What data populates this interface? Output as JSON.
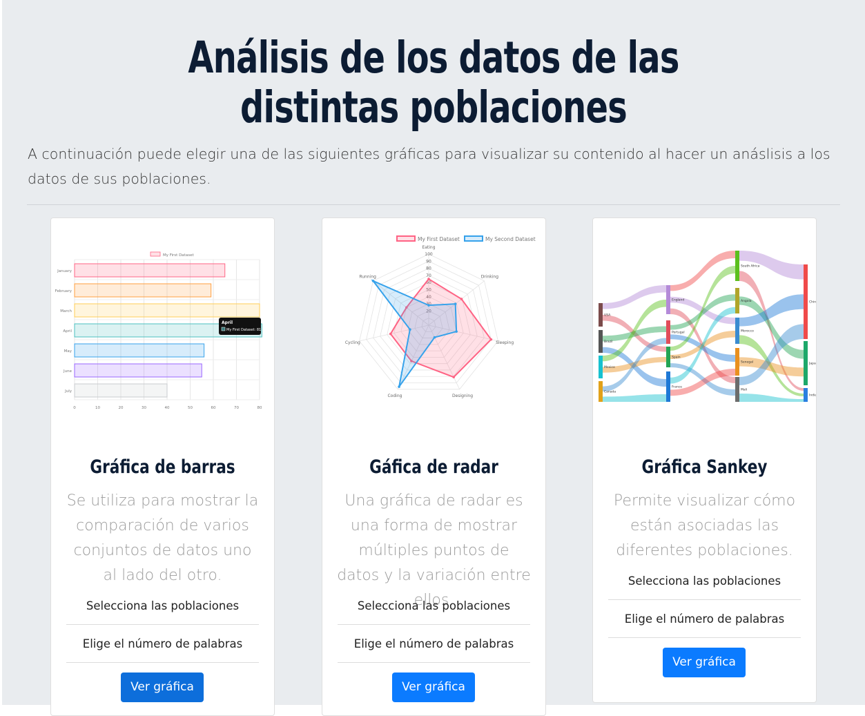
{
  "page": {
    "title": "Análisis de los datos de las distintas poblaciones",
    "intro": "A continuación puede elegir una de las siguientes gráficas para visualizar su contenido al hacer un anáslisis a los datos de sus poblaciones."
  },
  "cards": [
    {
      "title": "Gráfica de barras",
      "description": "Se utiliza para mostrar la comparación de varios conjuntos de datos uno al lado del otro.",
      "select_populations": "Selecciona las poblaciones",
      "choose_words": "Elige el número de palabras",
      "button": "Ver gráfica"
    },
    {
      "title": "Gáfica de radar",
      "description": "Una gráfica de radar es una forma de mostrar múltiples puntos de datos y la variación entre ellos.",
      "select_populations": "Selecciona las poblaciones",
      "choose_words": "Elige el número de palabras",
      "button": "Ver gráfica"
    },
    {
      "title": "Gráfica Sankey",
      "description": "Permite visualizar cómo están asociadas las diferentes poblaciones.",
      "select_populations": "Selecciona las poblaciones",
      "choose_words": "Elige el número de palabras",
      "button": "Ver gráfica"
    }
  ],
  "colors": {
    "background": "#e9ecef",
    "title": "#0c1c33",
    "button": "#0b7bff"
  },
  "chart_data": [
    {
      "type": "bar",
      "orientation": "horizontal",
      "legend": [
        "My First Dataset"
      ],
      "categories": [
        "January",
        "February",
        "March",
        "April",
        "May",
        "June",
        "July"
      ],
      "values": [
        65,
        59,
        80,
        81,
        56,
        55,
        40
      ],
      "xlim": [
        0,
        80
      ],
      "xticks": [
        "0",
        "10",
        "20",
        "30",
        "40",
        "50",
        "60",
        "70",
        "80"
      ],
      "tooltip": {
        "title": "April",
        "label": "My First Dataset: 81"
      },
      "colors": [
        "#ff6384",
        "#ff9f40",
        "#ffcd56",
        "#4bc0c0",
        "#36a2eb",
        "#9966ff",
        "#c9cbcf"
      ]
    },
    {
      "type": "radar",
      "axes": [
        "Eating",
        "Drinking",
        "Sleeping",
        "Designing",
        "Coding",
        "Cycling",
        "Running"
      ],
      "ticks": [
        "20",
        "30",
        "40",
        "50",
        "60",
        "70",
        "80",
        "90",
        "100"
      ],
      "series": [
        {
          "name": "My First Dataset",
          "values": [
            65,
            59,
            90,
            81,
            56,
            55,
            40
          ],
          "color": "#ff6384"
        },
        {
          "name": "My Second Dataset",
          "values": [
            28,
            48,
            40,
            19,
            96,
            27,
            100
          ],
          "color": "#36a2eb"
        }
      ]
    },
    {
      "type": "sankey",
      "nodes": {
        "left": [
          "USA",
          "Brazil",
          "Mexico",
          "Canada"
        ],
        "middle1": [
          "England",
          "Portugal",
          "Spain",
          "France"
        ],
        "middle2": [
          "South Africa",
          "Angola",
          "Morocco",
          "Senegal",
          "Mali"
        ],
        "right": [
          "China",
          "Japan",
          "India"
        ]
      }
    }
  ]
}
